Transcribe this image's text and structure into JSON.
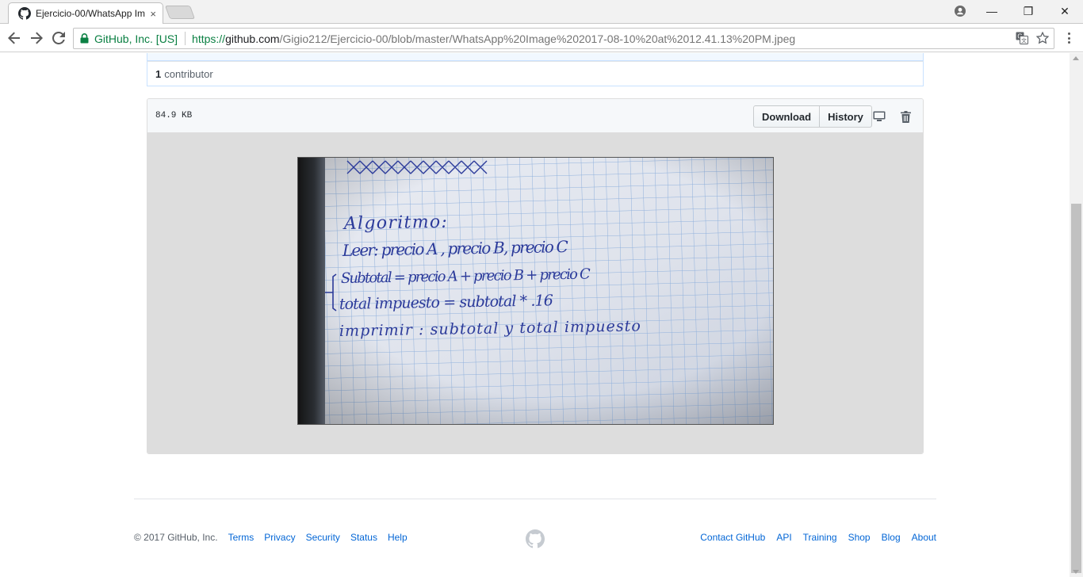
{
  "browser": {
    "tab_title": "Ejercicio-00/WhatsApp Im",
    "tab_close": "×",
    "window": {
      "minimize": "—",
      "restore": "❐",
      "close": "✕"
    },
    "omnibox": {
      "ev_label": "GitHub, Inc. [US]",
      "url_scheme": "https://",
      "url_host": "github.com",
      "url_path": "/Gigio212/Ejercicio-00/blob/master/WhatsApp%20Image%202017-08-10%20at%2012.41.13%20PM.jpeg"
    }
  },
  "contributors": {
    "count": "1",
    "label": "contributor"
  },
  "file": {
    "size": "84.9 KB",
    "download_label": "Download",
    "history_label": "History"
  },
  "image_content": {
    "lines": [
      "Algoritmo:",
      "Leer: precio A , precio B, precio C",
      "Subtotal = precio A + precio B + precio C",
      "total impuesto = subtotal * .16",
      "imprimir : subtotal y total impuesto"
    ]
  },
  "footer": {
    "copyright": "© 2017 GitHub, Inc.",
    "left_links": [
      "Terms",
      "Privacy",
      "Security",
      "Status",
      "Help"
    ],
    "right_links": [
      "Contact GitHub",
      "API",
      "Training",
      "Shop",
      "Blog",
      "About"
    ]
  },
  "colors": {
    "link": "#0366d6",
    "ev_green": "#0b8043",
    "ink": "#2b3a9a",
    "grid": "#8fb0dc"
  },
  "icons": [
    "github-favicon-icon",
    "back-arrow-icon",
    "forward-arrow-icon",
    "reload-icon",
    "lock-icon",
    "translate-icon",
    "star-icon",
    "menu-icon",
    "profile-icon",
    "desktop-icon",
    "trash-icon",
    "github-logo-icon"
  ]
}
